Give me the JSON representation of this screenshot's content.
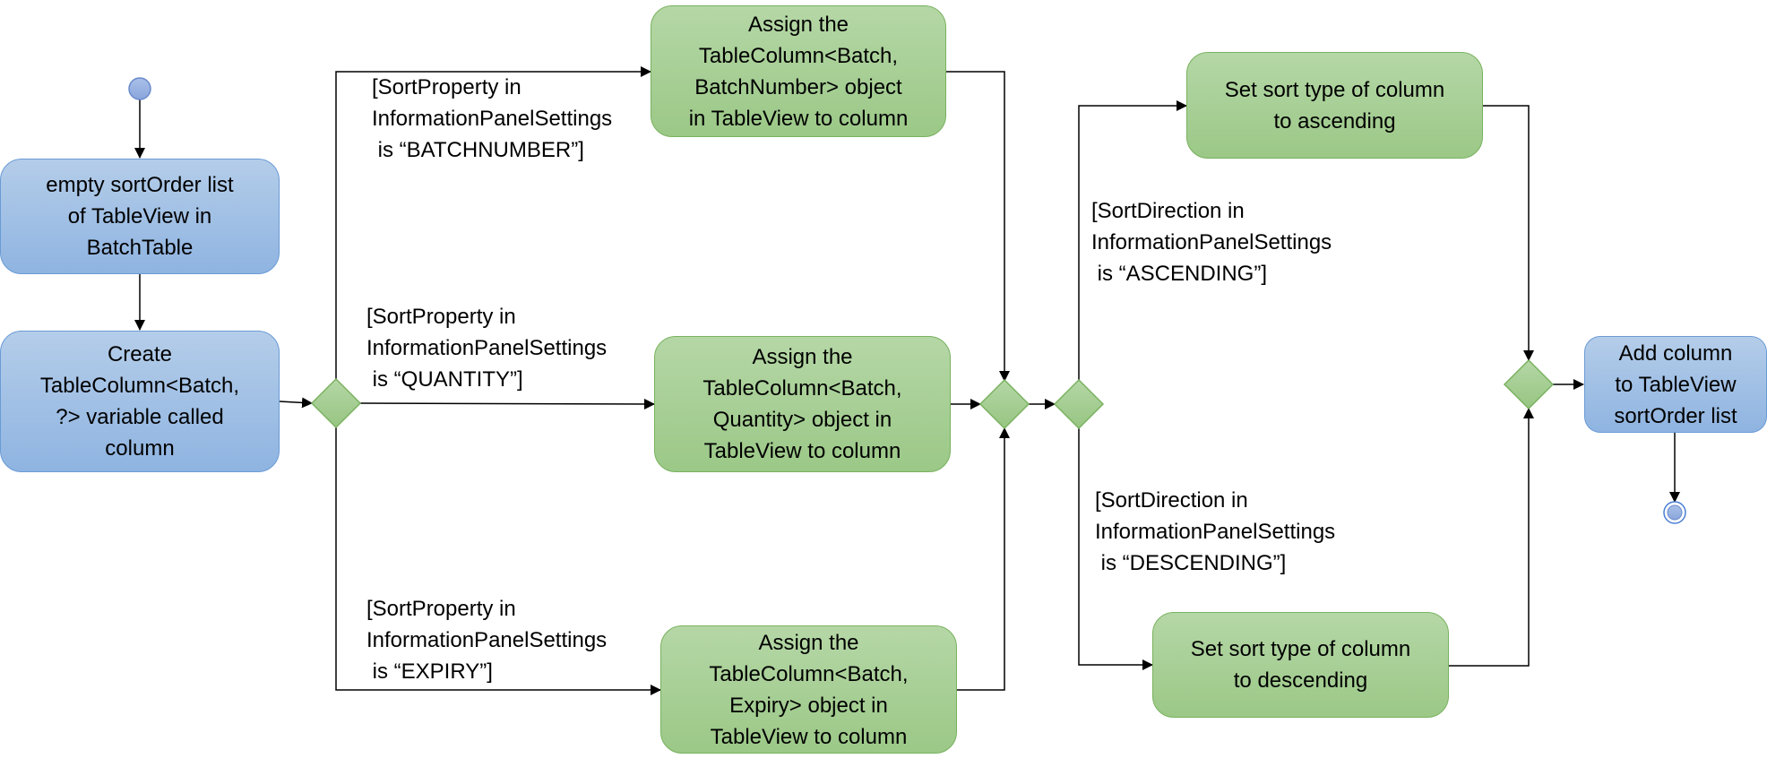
{
  "diagram": {
    "type": "uml-activity",
    "colors": {
      "action_blue": "#9dbfe5",
      "action_green": "#a8cf96",
      "line": "#000000"
    },
    "start": {
      "name": "initial-node"
    },
    "end": {
      "name": "final-node"
    },
    "actions": {
      "empty_sort_order": "empty sortOrder list\nof TableView in\nBatchTable",
      "create_column": "Create\nTableColumn<Batch,\n?> variable called\ncolumn",
      "assign_batchnumber": "Assign the\nTableColumn<Batch,\nBatchNumber> object\nin TableView to column",
      "assign_quantity": "Assign the\nTableColumn<Batch,\nQuantity> object in\nTableView to column",
      "assign_expiry": "Assign the\nTableColumn<Batch,\nExpiry> object in\nTableView to column",
      "set_ascending": "Set sort type of column\nto ascending",
      "set_descending": "Set sort type of column\nto descending",
      "add_column": "Add column\nto TableView\nsortOrder list"
    },
    "guards": {
      "batchnumber": "[SortProperty in\nInformationPanelSettings\n is “BATCHNUMBER”]",
      "quantity": "[SortProperty in\nInformationPanelSettings\n is “QUANTITY”]",
      "expiry": "[SortProperty in\nInformationPanelSettings\n is “EXPIRY”]",
      "ascending": "[SortDirection in\nInformationPanelSettings\n is “ASCENDING”]",
      "descending": "[SortDirection in\nInformationPanelSettings\n is “DESCENDING”]"
    }
  }
}
